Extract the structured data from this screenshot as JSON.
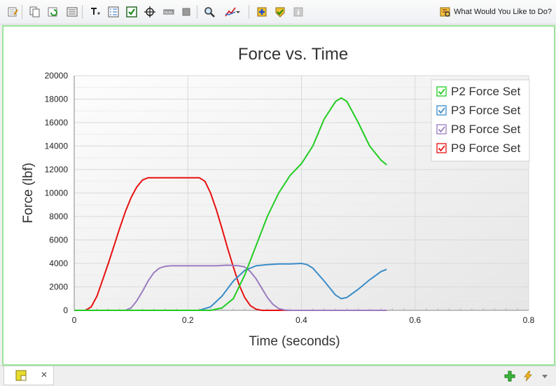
{
  "toolbar": {
    "buttons": [
      {
        "name": "edit-note-icon"
      },
      {
        "name": "copy-icon"
      },
      {
        "name": "refresh-icon"
      },
      {
        "name": "list-view-icon"
      },
      {
        "name": "text-format-icon"
      },
      {
        "name": "legend-icon"
      },
      {
        "name": "checkbox-icon"
      },
      {
        "name": "crosshair-icon"
      },
      {
        "name": "ruler-icon"
      },
      {
        "name": "stop-icon"
      },
      {
        "name": "zoom-icon"
      },
      {
        "name": "chart-style-icon"
      },
      {
        "name": "add-icon"
      },
      {
        "name": "check-shield-icon"
      },
      {
        "name": "info-disabled-icon"
      }
    ],
    "help_label": "What Would You Like to Do?"
  },
  "colors": {
    "frame_border": "#9be39b",
    "p2": "#22cc22",
    "p3": "#3a8cc8",
    "p8": "#9a7cc0",
    "p9": "#e81010"
  },
  "chart_data": {
    "type": "line",
    "title": "Force vs. Time",
    "xlabel": "Time (seconds)",
    "ylabel": "Force (lbf)",
    "xlim": [
      0,
      0.8
    ],
    "ylim": [
      0,
      20000
    ],
    "xticks": [
      0,
      0.2,
      0.4,
      0.6,
      0.8
    ],
    "yticks": [
      0,
      2000,
      4000,
      6000,
      8000,
      10000,
      12000,
      14000,
      16000,
      18000,
      20000
    ],
    "grid": true,
    "legend_position": "top-right",
    "series": [
      {
        "name": "P2 Force Set",
        "color": "#22cc22",
        "x": [
          0,
          0.24,
          0.26,
          0.28,
          0.3,
          0.32,
          0.34,
          0.36,
          0.38,
          0.4,
          0.42,
          0.44,
          0.46,
          0.47,
          0.48,
          0.5,
          0.52,
          0.54,
          0.55
        ],
        "y": [
          0,
          0,
          200,
          1000,
          3000,
          5500,
          8000,
          10000,
          11500,
          12500,
          14000,
          16300,
          17800,
          18100,
          17800,
          16000,
          14000,
          12800,
          12400
        ]
      },
      {
        "name": "P3 Force Set",
        "color": "#3a8cc8",
        "x": [
          0,
          0.22,
          0.24,
          0.26,
          0.28,
          0.3,
          0.32,
          0.34,
          0.36,
          0.38,
          0.4,
          0.41,
          0.42,
          0.44,
          0.46,
          0.47,
          0.48,
          0.5,
          0.52,
          0.54,
          0.55
        ],
        "y": [
          0,
          0,
          300,
          1200,
          2500,
          3400,
          3800,
          3900,
          3950,
          3950,
          4000,
          3900,
          3600,
          2500,
          1300,
          1000,
          1100,
          1800,
          2600,
          3300,
          3500
        ]
      },
      {
        "name": "P8 Force Set",
        "color": "#9a7cc0",
        "x": [
          0,
          0.09,
          0.1,
          0.11,
          0.12,
          0.13,
          0.14,
          0.15,
          0.16,
          0.17,
          0.2,
          0.25,
          0.27,
          0.29,
          0.3,
          0.31,
          0.32,
          0.33,
          0.34,
          0.35,
          0.36,
          0.37,
          0.38,
          0.4,
          0.55
        ],
        "y": [
          0,
          0,
          200,
          800,
          1600,
          2500,
          3200,
          3600,
          3750,
          3800,
          3800,
          3800,
          3850,
          3800,
          3700,
          3300,
          2700,
          1900,
          1100,
          500,
          150,
          30,
          0,
          0,
          0
        ]
      },
      {
        "name": "P9 Force Set",
        "color": "#e81010",
        "x": [
          0,
          0.02,
          0.03,
          0.04,
          0.05,
          0.06,
          0.07,
          0.08,
          0.09,
          0.1,
          0.11,
          0.12,
          0.13,
          0.15,
          0.2,
          0.22,
          0.23,
          0.24,
          0.25,
          0.26,
          0.27,
          0.28,
          0.29,
          0.3,
          0.31,
          0.32,
          0.33,
          0.34,
          0.55
        ],
        "y": [
          0,
          0,
          300,
          1200,
          2600,
          4000,
          5500,
          7000,
          8400,
          9600,
          10500,
          11100,
          11300,
          11300,
          11300,
          11300,
          11000,
          10000,
          8600,
          7000,
          5300,
          3700,
          2200,
          1100,
          400,
          100,
          0,
          0,
          0
        ]
      }
    ]
  }
}
